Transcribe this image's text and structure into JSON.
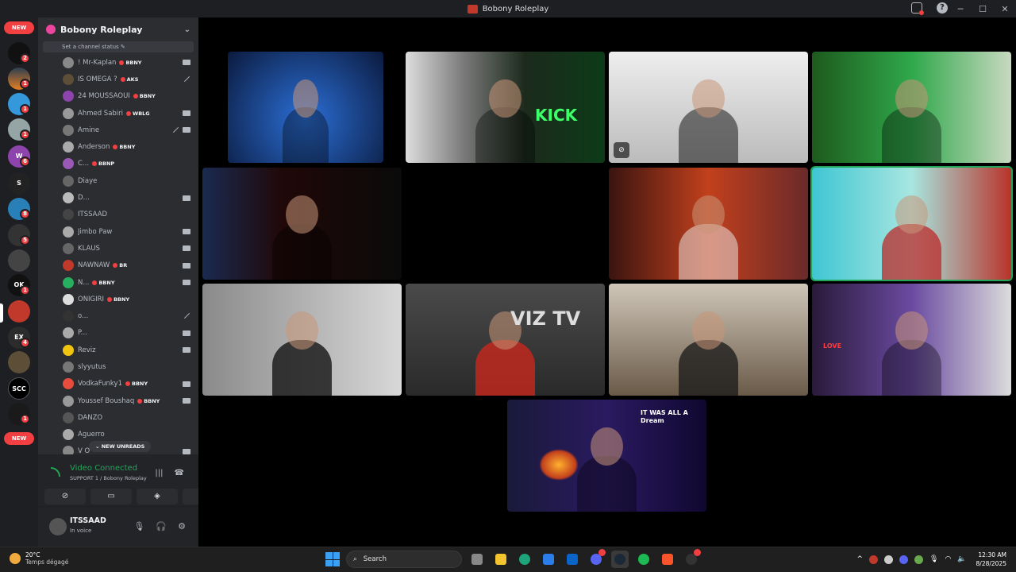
{
  "window": {
    "title": "Bobony Roleplay"
  },
  "rail": {
    "new_label": "NEW",
    "badges": [
      "2",
      "1",
      "1",
      "1",
      "6",
      "8",
      "5",
      "1",
      "4",
      "1"
    ]
  },
  "sidebar": {
    "guild_name": "Bobony Roleplay",
    "set_status": "Set a channel status",
    "new_unreads": "NEW UNREADS",
    "users": [
      {
        "name": "! Mr-Kaplan",
        "tag": "BBNY",
        "cam": "on"
      },
      {
        "name": "IS OMEGA ?",
        "tag": "AKS",
        "cam": "off"
      },
      {
        "name": "24 MOUSSAOUI",
        "tag": "BBNY",
        "cam": ""
      },
      {
        "name": "Ahmed Sabiri",
        "tag": "WBLG",
        "cam": "on"
      },
      {
        "name": "Amine",
        "tag": "",
        "cam": "both"
      },
      {
        "name": "Anderson",
        "tag": "BBNY",
        "cam": ""
      },
      {
        "name": "C...",
        "tag": "BBNP",
        "cam": ""
      },
      {
        "name": "Diaye",
        "tag": "",
        "cam": ""
      },
      {
        "name": "D...",
        "tag": "",
        "cam": "on"
      },
      {
        "name": "ITSSAAD",
        "tag": "",
        "cam": ""
      },
      {
        "name": "Jimbo Paw",
        "tag": "",
        "cam": "on"
      },
      {
        "name": "KLAUS",
        "tag": "",
        "cam": "on"
      },
      {
        "name": "NAWNAW",
        "tag": "BR",
        "cam": "on"
      },
      {
        "name": "N...",
        "tag": "BBNY",
        "cam": "on"
      },
      {
        "name": "ONIGIRI",
        "tag": "BBNY",
        "cam": ""
      },
      {
        "name": "o...",
        "tag": "",
        "cam": "off"
      },
      {
        "name": "P...",
        "tag": "",
        "cam": "on"
      },
      {
        "name": "Reviz",
        "tag": "",
        "cam": "on"
      },
      {
        "name": "slyyutus",
        "tag": "",
        "cam": ""
      },
      {
        "name": "VodkaFunky1",
        "tag": "BBNY",
        "cam": "on"
      },
      {
        "name": "Youssef Boushaq",
        "tag": "BBNY",
        "cam": "on"
      },
      {
        "name": "DANZO",
        "tag": "",
        "cam": ""
      },
      {
        "name": "Aguerro",
        "tag": "",
        "cam": ""
      },
      {
        "name": "V O",
        "tag": "",
        "cam": "on"
      }
    ]
  },
  "voice": {
    "connected": "Video Connected",
    "channel": "SUPPORT 1 / Bobony Roleplay"
  },
  "user": {
    "name": "ITSSAAD",
    "status": "In voice"
  },
  "tiles": {
    "t2_sign": "KICK",
    "t6_sign": "VIZ TV",
    "t8_sign": "LOVE",
    "t9_sign": "IT WAS ALL A Dream"
  },
  "taskbar": {
    "temp": "20°C",
    "weather": "Temps dégagé",
    "search": "Search",
    "time": "12:30 AM",
    "date": "8/28/2025"
  }
}
